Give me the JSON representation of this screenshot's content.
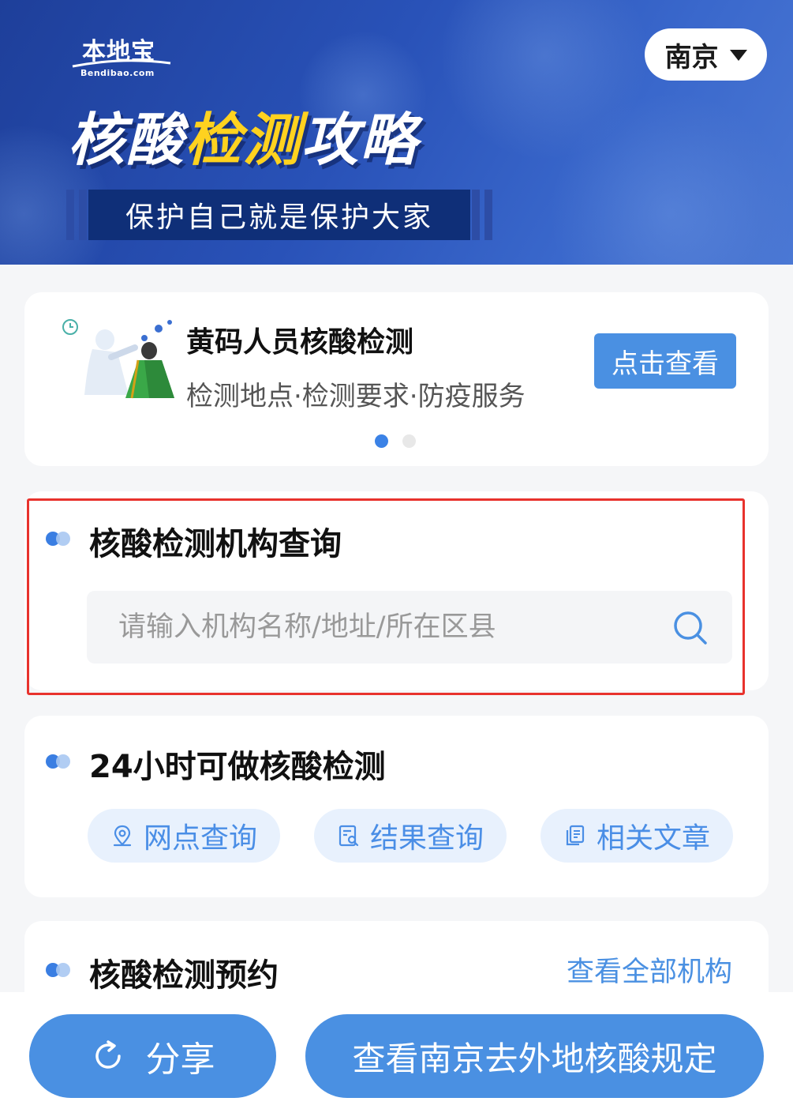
{
  "banner": {
    "logo_text": "本地宝",
    "logo_domain": "Bendibao.com",
    "city": "南京",
    "title_part1": "核酸",
    "title_part2": "检测",
    "title_part3": "攻略",
    "subtitle": "保护自己就是保护大家"
  },
  "promo": {
    "title": "黄码人员核酸检测",
    "subtitle": "检测地点·检测要求·防疫服务",
    "button": "点击查看",
    "pager_total": 2,
    "pager_active": 1
  },
  "search": {
    "title": "核酸检测机构查询",
    "placeholder": "请输入机构名称/地址/所在区县"
  },
  "h24": {
    "title": "24小时可做核酸检测",
    "buttons": [
      "网点查询",
      "结果查询",
      "相关文章"
    ]
  },
  "booking": {
    "title": "核酸检测预约",
    "view_all": "查看全部机构"
  },
  "bottom": {
    "share": "分享",
    "rules": "查看南京去外地核酸规定"
  },
  "colors": {
    "accent": "#4a90e2",
    "highlight": "#e8322d",
    "title_yellow": "#ffd21f",
    "banner_blue": "#2952b8"
  }
}
